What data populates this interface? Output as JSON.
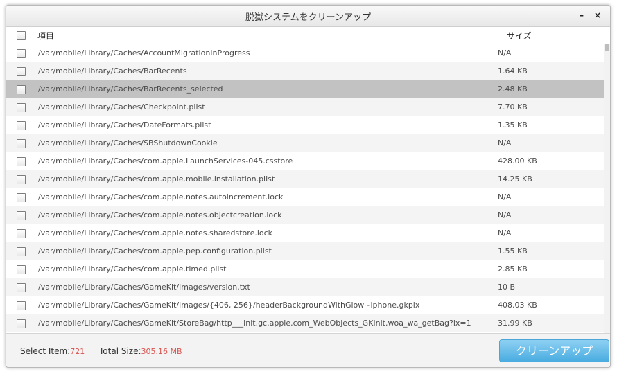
{
  "window": {
    "title": "脱獄システムをクリーンアップ",
    "minimize_icon": "minimize-icon",
    "close_icon": "close-icon",
    "minimize_glyph": "–",
    "close_glyph": "×"
  },
  "header": {
    "name_label": "項目",
    "size_label": "サイズ"
  },
  "rows": [
    {
      "path": "/var/mobile/Library/Caches/AccountMigrationInProgress",
      "size": "N/A"
    },
    {
      "path": "/var/mobile/Library/Caches/BarRecents",
      "size": "1.64 KB"
    },
    {
      "path": "/var/mobile/Library/Caches/BarRecents_selected",
      "size": "2.48 KB"
    },
    {
      "path": "/var/mobile/Library/Caches/Checkpoint.plist",
      "size": "7.70 KB"
    },
    {
      "path": "/var/mobile/Library/Caches/DateFormats.plist",
      "size": "1.35 KB"
    },
    {
      "path": "/var/mobile/Library/Caches/SBShutdownCookie",
      "size": "N/A"
    },
    {
      "path": "/var/mobile/Library/Caches/com.apple.LaunchServices-045.csstore",
      "size": "428.00 KB"
    },
    {
      "path": "/var/mobile/Library/Caches/com.apple.mobile.installation.plist",
      "size": "14.25 KB"
    },
    {
      "path": "/var/mobile/Library/Caches/com.apple.notes.autoincrement.lock",
      "size": "N/A"
    },
    {
      "path": "/var/mobile/Library/Caches/com.apple.notes.objectcreation.lock",
      "size": "N/A"
    },
    {
      "path": "/var/mobile/Library/Caches/com.apple.notes.sharedstore.lock",
      "size": "N/A"
    },
    {
      "path": "/var/mobile/Library/Caches/com.apple.pep.configuration.plist",
      "size": "1.55 KB"
    },
    {
      "path": "/var/mobile/Library/Caches/com.apple.timed.plist",
      "size": "2.85 KB"
    },
    {
      "path": "/var/mobile/Library/Caches/GameKit/Images/version.txt",
      "size": "10 B"
    },
    {
      "path": "/var/mobile/Library/Caches/GameKit/Images/{406, 256}/headerBackgroundWithGlow~iphone.gkpix",
      "size": "408.03 KB"
    },
    {
      "path": "/var/mobile/Library/Caches/GameKit/StoreBag/http___init.gc.apple.com_WebObjects_GKInit.woa_wa_getBag?ix=1",
      "size": "31.99 KB"
    }
  ],
  "selected_row_index": 2,
  "footer": {
    "select_label": "Select Item:",
    "select_value": "721",
    "total_label": "Total Size:",
    "total_value": "305.16 MB",
    "clean_button": "クリーンアップ"
  },
  "colors": {
    "accent_button": "#49ace0",
    "value_red": "#d9534f",
    "selected_row": "#c2c2c2"
  }
}
